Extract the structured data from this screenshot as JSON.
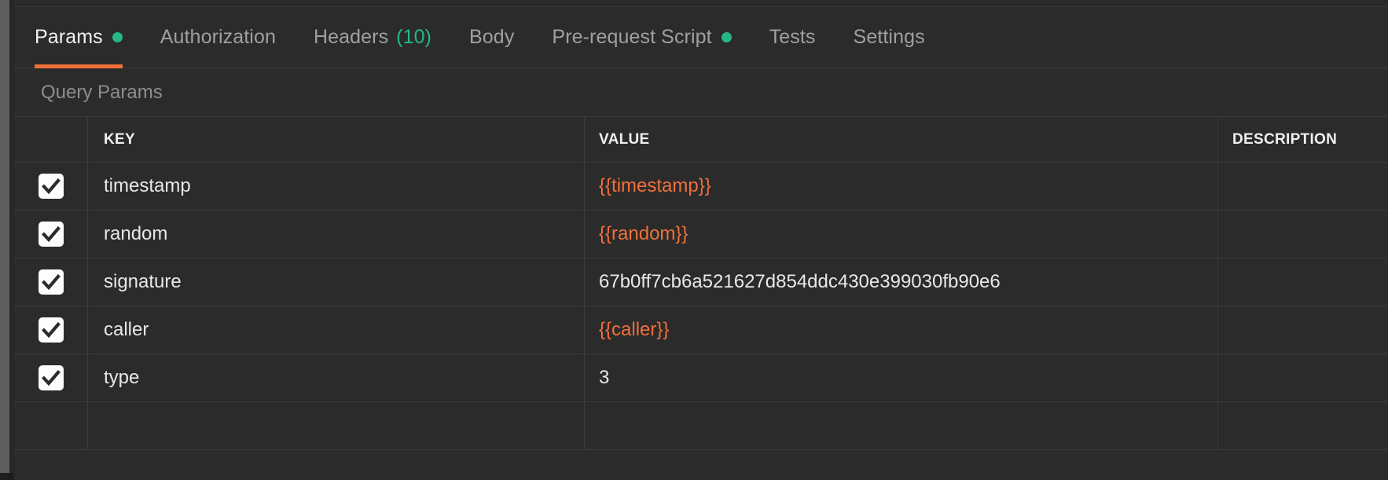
{
  "colors": {
    "accent_orange": "#f0703a",
    "accent_green": "#25b884",
    "panel_bg": "#2b2b2b",
    "border": "#3c3c3c",
    "text_primary": "#e8e8e8",
    "text_muted": "#a0a0a0"
  },
  "tabs": [
    {
      "label": "Params",
      "active": true,
      "dot": true,
      "count": ""
    },
    {
      "label": "Authorization",
      "active": false,
      "dot": false,
      "count": ""
    },
    {
      "label": "Headers",
      "active": false,
      "dot": false,
      "count": "(10)"
    },
    {
      "label": "Body",
      "active": false,
      "dot": false,
      "count": ""
    },
    {
      "label": "Pre-request Script",
      "active": false,
      "dot": true,
      "count": ""
    },
    {
      "label": "Tests",
      "active": false,
      "dot": false,
      "count": ""
    },
    {
      "label": "Settings",
      "active": false,
      "dot": false,
      "count": ""
    }
  ],
  "section": {
    "title": "Query Params"
  },
  "table": {
    "columns": [
      "KEY",
      "VALUE",
      "DESCRIPTION"
    ],
    "rows": [
      {
        "checked": true,
        "key": "timestamp",
        "value": "{{timestamp}}",
        "value_is_template": true,
        "description": ""
      },
      {
        "checked": true,
        "key": "random",
        "value": "{{random}}",
        "value_is_template": true,
        "description": ""
      },
      {
        "checked": true,
        "key": "signature",
        "value": "67b0ff7cb6a521627d854ddc430e399030fb90e6",
        "value_is_template": false,
        "description": ""
      },
      {
        "checked": true,
        "key": "caller",
        "value": "{{caller}}",
        "value_is_template": true,
        "description": ""
      },
      {
        "checked": true,
        "key": "type",
        "value": "3",
        "value_is_template": false,
        "description": ""
      },
      {
        "checked": true,
        "key": "",
        "value": "",
        "value_is_template": false,
        "description": ""
      }
    ]
  }
}
